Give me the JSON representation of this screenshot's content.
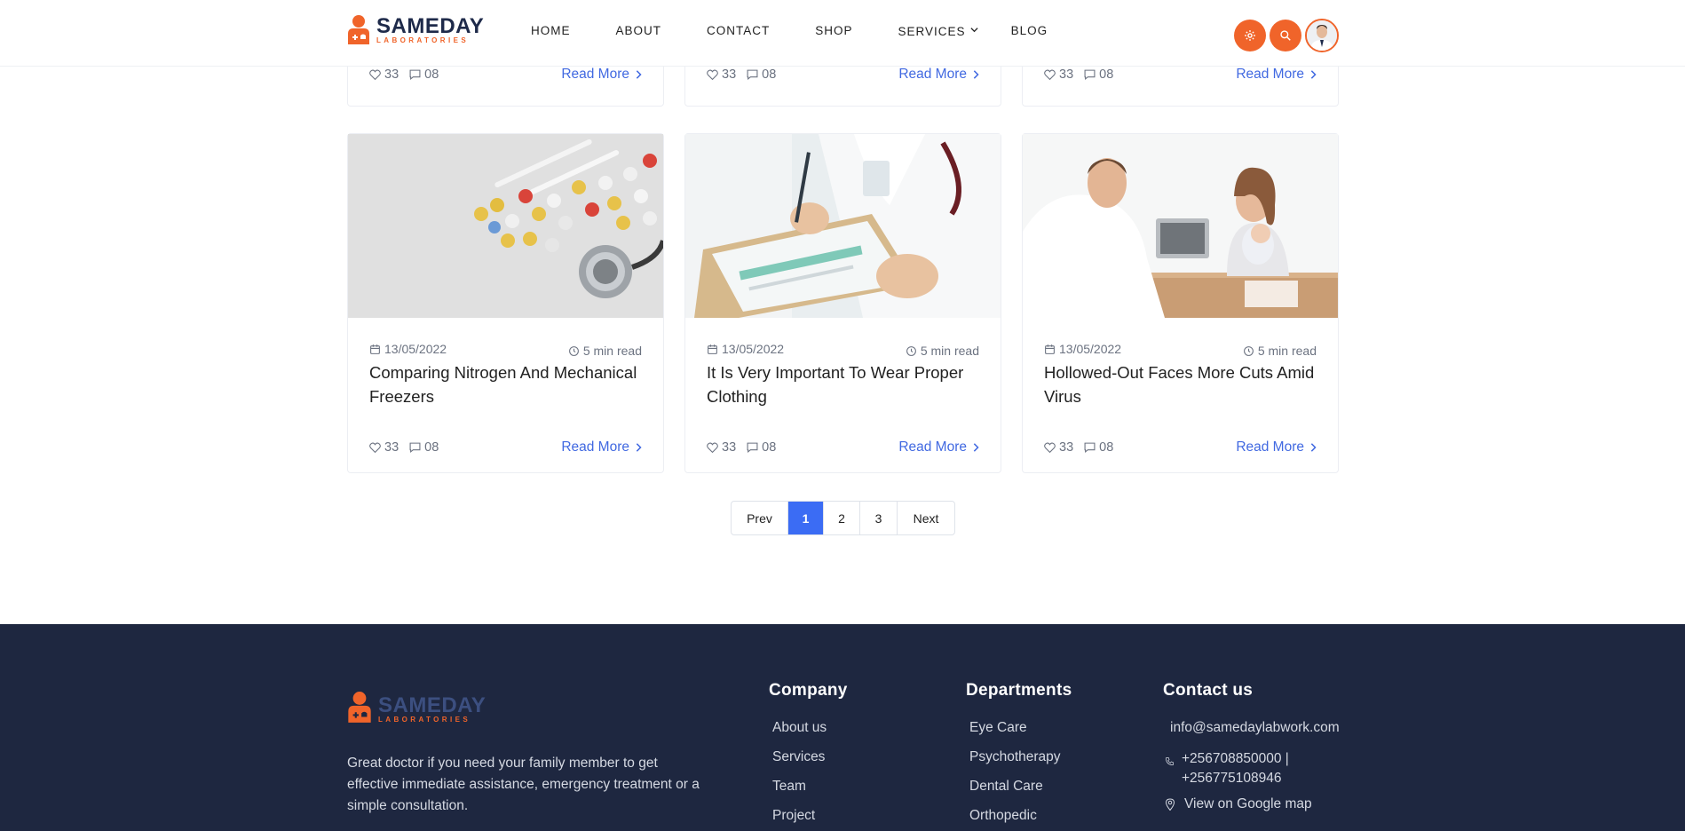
{
  "brand": {
    "name": "SAMEDAY",
    "tagline": "LABORATORIES",
    "accent": "#f0642a",
    "navy": "#1e2a4a",
    "link_blue": "#4169e1"
  },
  "nav": {
    "items": [
      {
        "label": "HOME"
      },
      {
        "label": "ABOUT"
      },
      {
        "label": "CONTACT"
      },
      {
        "label": "SHOP"
      },
      {
        "label": "SERVICES"
      },
      {
        "label": "BLOG"
      }
    ]
  },
  "header_buttons": {
    "settings_icon": "gear-icon",
    "search_icon": "search-icon",
    "avatar_icon": "user-avatar"
  },
  "top_cards": [
    {
      "likes": "33",
      "comments": "08",
      "read_more": "Read More"
    },
    {
      "likes": "33",
      "comments": "08",
      "read_more": "Read More"
    },
    {
      "likes": "33",
      "comments": "08",
      "read_more": "Read More"
    }
  ],
  "cards": [
    {
      "date": "13/05/2022",
      "read_time": "5 min read",
      "title": "Comparing Nitrogen And Mechanical Freezers",
      "likes": "33",
      "comments": "08",
      "read_more": "Read More",
      "image": "pills-and-stethoscope"
    },
    {
      "date": "13/05/2022",
      "read_time": "5 min read",
      "title": "It Is Very Important To Wear Proper Clothing",
      "likes": "33",
      "comments": "08",
      "read_more": "Read More",
      "image": "doctor-writing-clipboard"
    },
    {
      "date": "13/05/2022",
      "read_time": "5 min read",
      "title": "Hollowed-Out Faces More Cuts Amid Virus",
      "likes": "33",
      "comments": "08",
      "read_more": "Read More",
      "image": "doctor-with-mother-and-baby"
    }
  ],
  "pagination": {
    "prev": "Prev",
    "pages": [
      "1",
      "2",
      "3"
    ],
    "current": "1",
    "next": "Next"
  },
  "footer": {
    "about": "Great doctor if you need your family member to get effective immediate assistance, emergency treatment or a simple consultation.",
    "company": {
      "heading": "Company",
      "links": [
        "About us",
        "Services",
        "Team",
        "Project"
      ]
    },
    "departments": {
      "heading": "Departments",
      "links": [
        "Eye Care",
        "Psychotherapy",
        "Dental Care",
        "Orthopedic"
      ]
    },
    "contact": {
      "heading": "Contact us",
      "email": "info@samedaylabwork.com",
      "phone_1": "+256708850000 |",
      "phone_2": "+256775108946",
      "map": "View on Google map"
    }
  }
}
